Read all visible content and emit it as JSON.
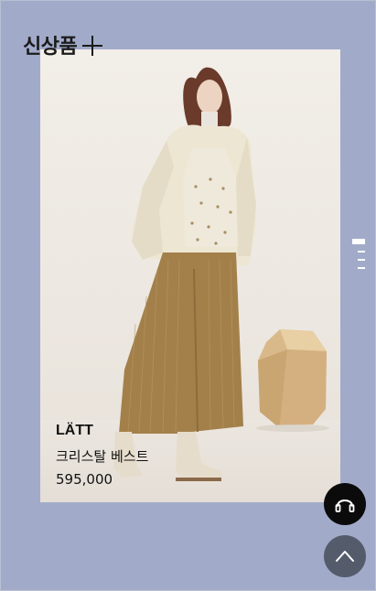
{
  "section": {
    "title": "신상품"
  },
  "product": {
    "brand": "LÄTT",
    "name": "크리스탈 베스트",
    "price": "595,000"
  },
  "pager": {
    "count": 4,
    "active_index": 0
  },
  "buttons": {
    "support_icon": "headset-icon",
    "top_icon": "chevron-up-icon"
  },
  "colors": {
    "background": "#a1abc9",
    "fab_dark": "#0b0b0b",
    "fab_gray": "#545b6b"
  }
}
